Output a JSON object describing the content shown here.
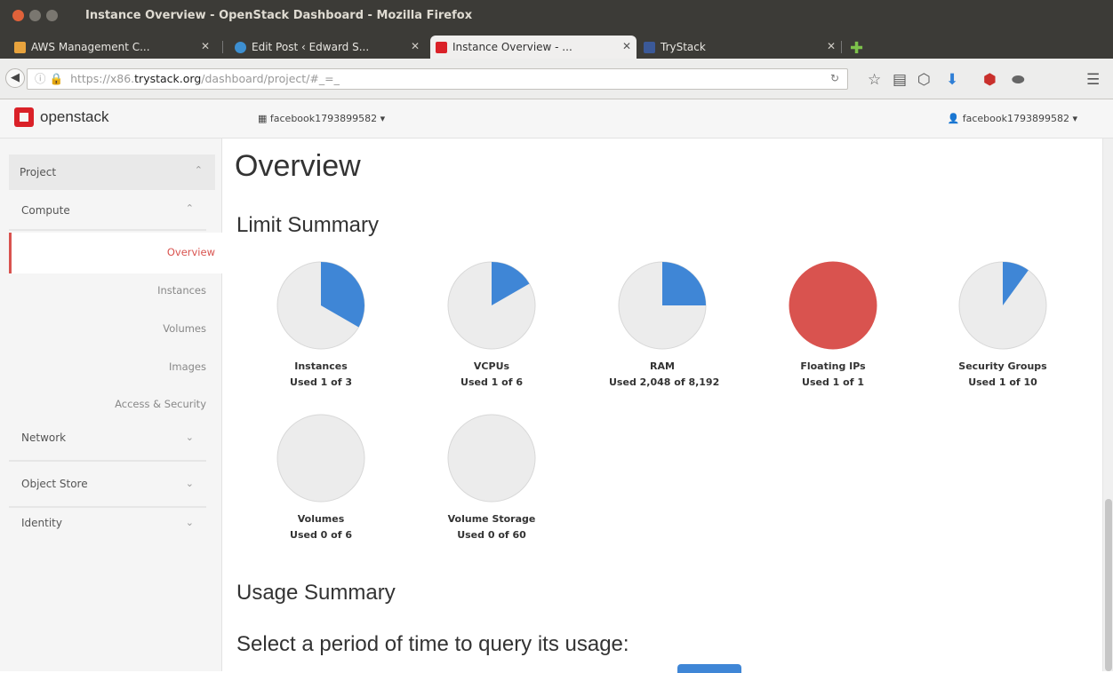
{
  "window": {
    "title": "Instance Overview - OpenStack Dashboard - Mozilla Firefox"
  },
  "tabs": [
    {
      "label": "AWS Management C...",
      "icon": "aws-cube-icon",
      "color": "#e8a33d"
    },
    {
      "label": "Edit Post ‹ Edward S...",
      "icon": "wordpress-icon",
      "color": "#3d8fd1"
    },
    {
      "label": "Instance Overview - ...",
      "icon": "openstack-icon",
      "color": "#da2128"
    },
    {
      "label": "TryStack",
      "icon": "facebook-icon",
      "color": "#3b5998"
    }
  ],
  "urlbar": {
    "proto": "https://x86.",
    "domain": "trystack.org",
    "path": "/dashboard/project/#_=_"
  },
  "header": {
    "logo_text": "openstack",
    "project_selector": "facebook1793899582 ▾",
    "user_menu": "facebook1793899582 ▾"
  },
  "sidebar": {
    "project": "Project",
    "compute": "Compute",
    "compute_items": [
      "Overview",
      "Instances",
      "Volumes",
      "Images",
      "Access & Security"
    ],
    "network": "Network",
    "object_store": "Object Store",
    "identity": "Identity"
  },
  "main": {
    "title": "Overview",
    "limit_summary": "Limit Summary",
    "usage_summary": "Usage Summary",
    "period_prompt": "Select a period of time to query its usage:"
  },
  "limits": [
    {
      "name": "Instances",
      "usage": "Used 1 of 3",
      "used": 1,
      "total": 3
    },
    {
      "name": "VCPUs",
      "usage": "Used 1 of 6",
      "used": 1,
      "total": 6
    },
    {
      "name": "RAM",
      "usage": "Used 2,048 of 8,192",
      "used": 2048,
      "total": 8192
    },
    {
      "name": "Floating IPs",
      "usage": "Used 1 of 1",
      "used": 1,
      "total": 1
    },
    {
      "name": "Security Groups",
      "usage": "Used 1 of 10",
      "used": 1,
      "total": 10
    },
    {
      "name": "Volumes",
      "usage": "Used 0 of 6",
      "used": 0,
      "total": 6
    },
    {
      "name": "Volume Storage",
      "usage": "Used 0 of 60",
      "used": 0,
      "total": 60
    }
  ],
  "colors": {
    "used": "#3f86d6",
    "full": "#d9534f",
    "empty": "#ececec",
    "accent": "#d9534f"
  }
}
